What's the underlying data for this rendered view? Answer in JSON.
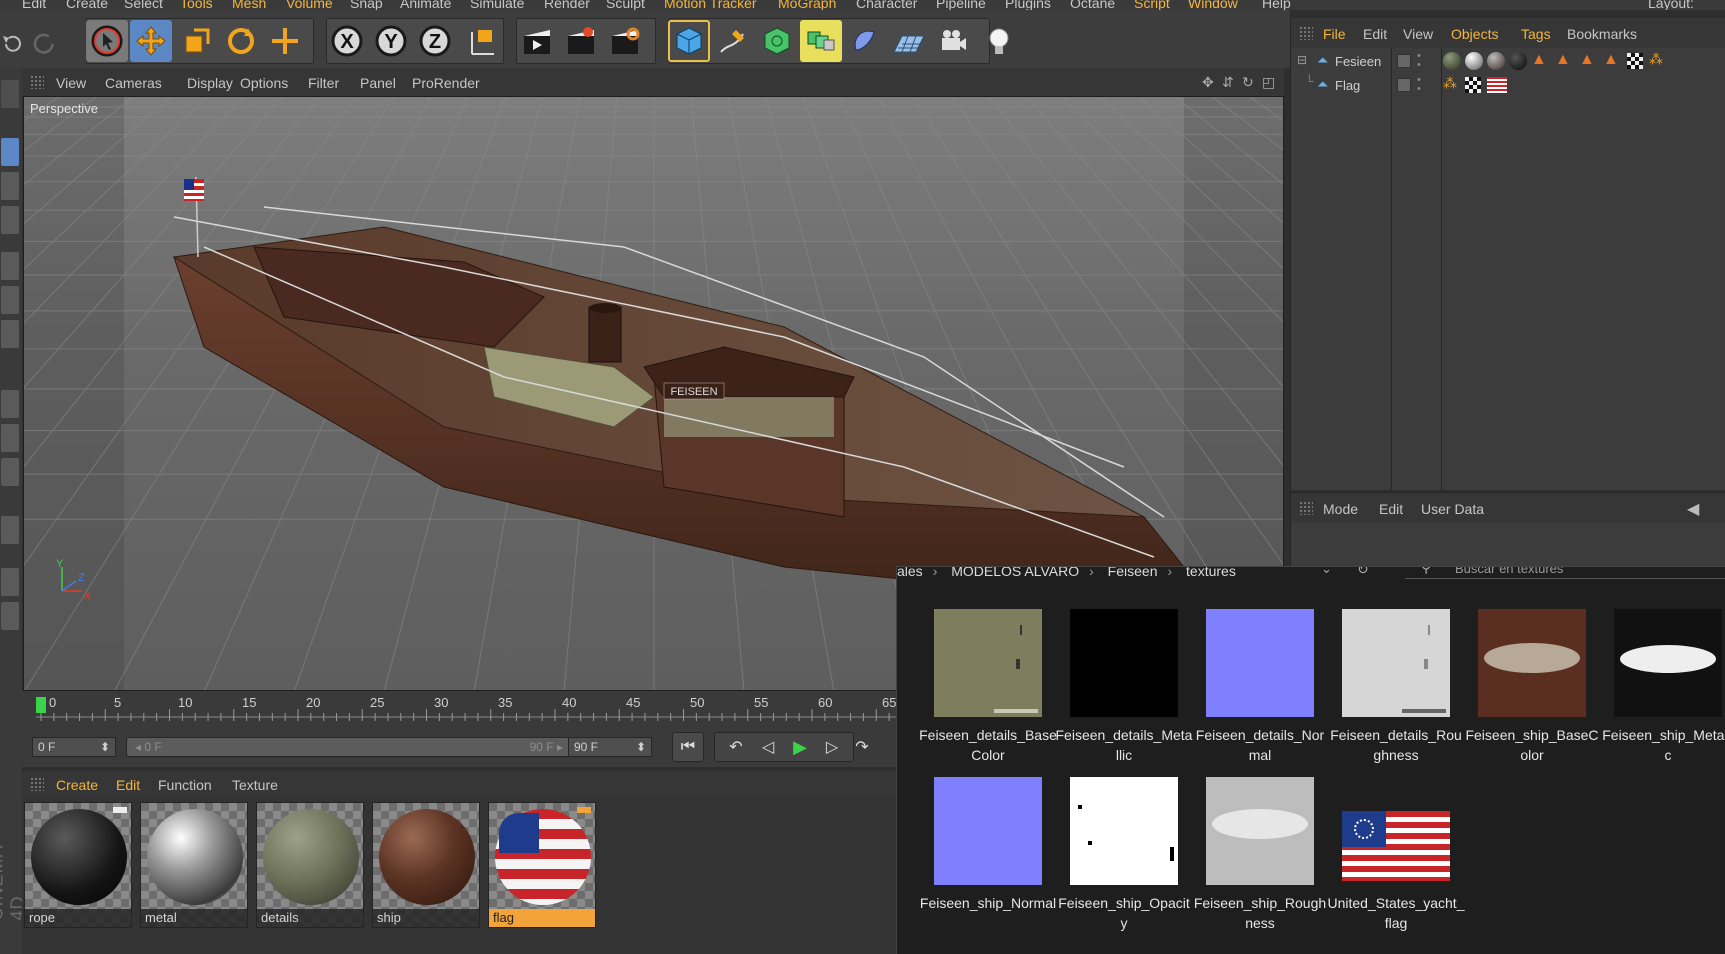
{
  "menubar": {
    "items": [
      "Edit",
      "Create",
      "Select",
      "Tools",
      "Mesh",
      "Volume",
      "Snap",
      "Animate",
      "Simulate",
      "Render",
      "Sculpt",
      "Motion Tracker",
      "MoGraph",
      "Character",
      "Pipeline",
      "Plugins",
      "Octane",
      "Script",
      "Window",
      "Help"
    ],
    "layout_label": "Layout:"
  },
  "toolbar": {
    "axis_x": "X",
    "axis_y": "Y",
    "axis_z": "Z"
  },
  "viewport": {
    "menu": [
      "View",
      "Cameras",
      "Display",
      "Options",
      "Filter",
      "Panel",
      "ProRender"
    ],
    "label": "Perspective",
    "axis_y": "Y",
    "axis_z": "Z",
    "axis_x": "X",
    "boat_nameplate": "FEISEEN"
  },
  "timeline": {
    "ticks": [
      "0",
      "5",
      "10",
      "15",
      "20",
      "25",
      "30",
      "35",
      "40",
      "45",
      "50",
      "55",
      "60",
      "65"
    ],
    "start_field": "0 F",
    "range_start": "0 F",
    "range_end": "90 F",
    "end_field": "90 F"
  },
  "materials": {
    "menu": [
      "Create",
      "Edit",
      "Function",
      "Texture"
    ],
    "items": [
      {
        "name": "rope"
      },
      {
        "name": "metal"
      },
      {
        "name": "details"
      },
      {
        "name": "ship"
      },
      {
        "name": "flag"
      }
    ],
    "selected": "flag"
  },
  "objects": {
    "menu": [
      "File",
      "Edit",
      "View",
      "Objects",
      "Tags",
      "Bookmarks"
    ],
    "rows": [
      {
        "name": "Fesieen"
      },
      {
        "name": "Flag"
      }
    ]
  },
  "attributes": {
    "menu": [
      "Mode",
      "Edit",
      "User Data"
    ]
  },
  "explorer": {
    "breadcrumb": [
      "ales",
      "MODELOS ALVARO",
      "Feiseen",
      "textures"
    ],
    "search_placeholder": "Buscar en textures",
    "files": [
      {
        "name": "Feiseen_details_BaseColor"
      },
      {
        "name": "Feiseen_details_Metallic"
      },
      {
        "name": "Feiseen_details_Normal"
      },
      {
        "name": "Feiseen_details_Roughness"
      },
      {
        "name": "Feiseen_ship_BaseColor"
      },
      {
        "name": "Feiseen_ship_Metallic"
      },
      {
        "name": "Feiseen_ship_Normal"
      },
      {
        "name": "Feiseen_ship_Opacity"
      },
      {
        "name": "Feiseen_ship_Roughness"
      },
      {
        "name": "United_States_yacht_flag"
      }
    ]
  },
  "branding": {
    "vertical": "CINEMA 4D"
  }
}
